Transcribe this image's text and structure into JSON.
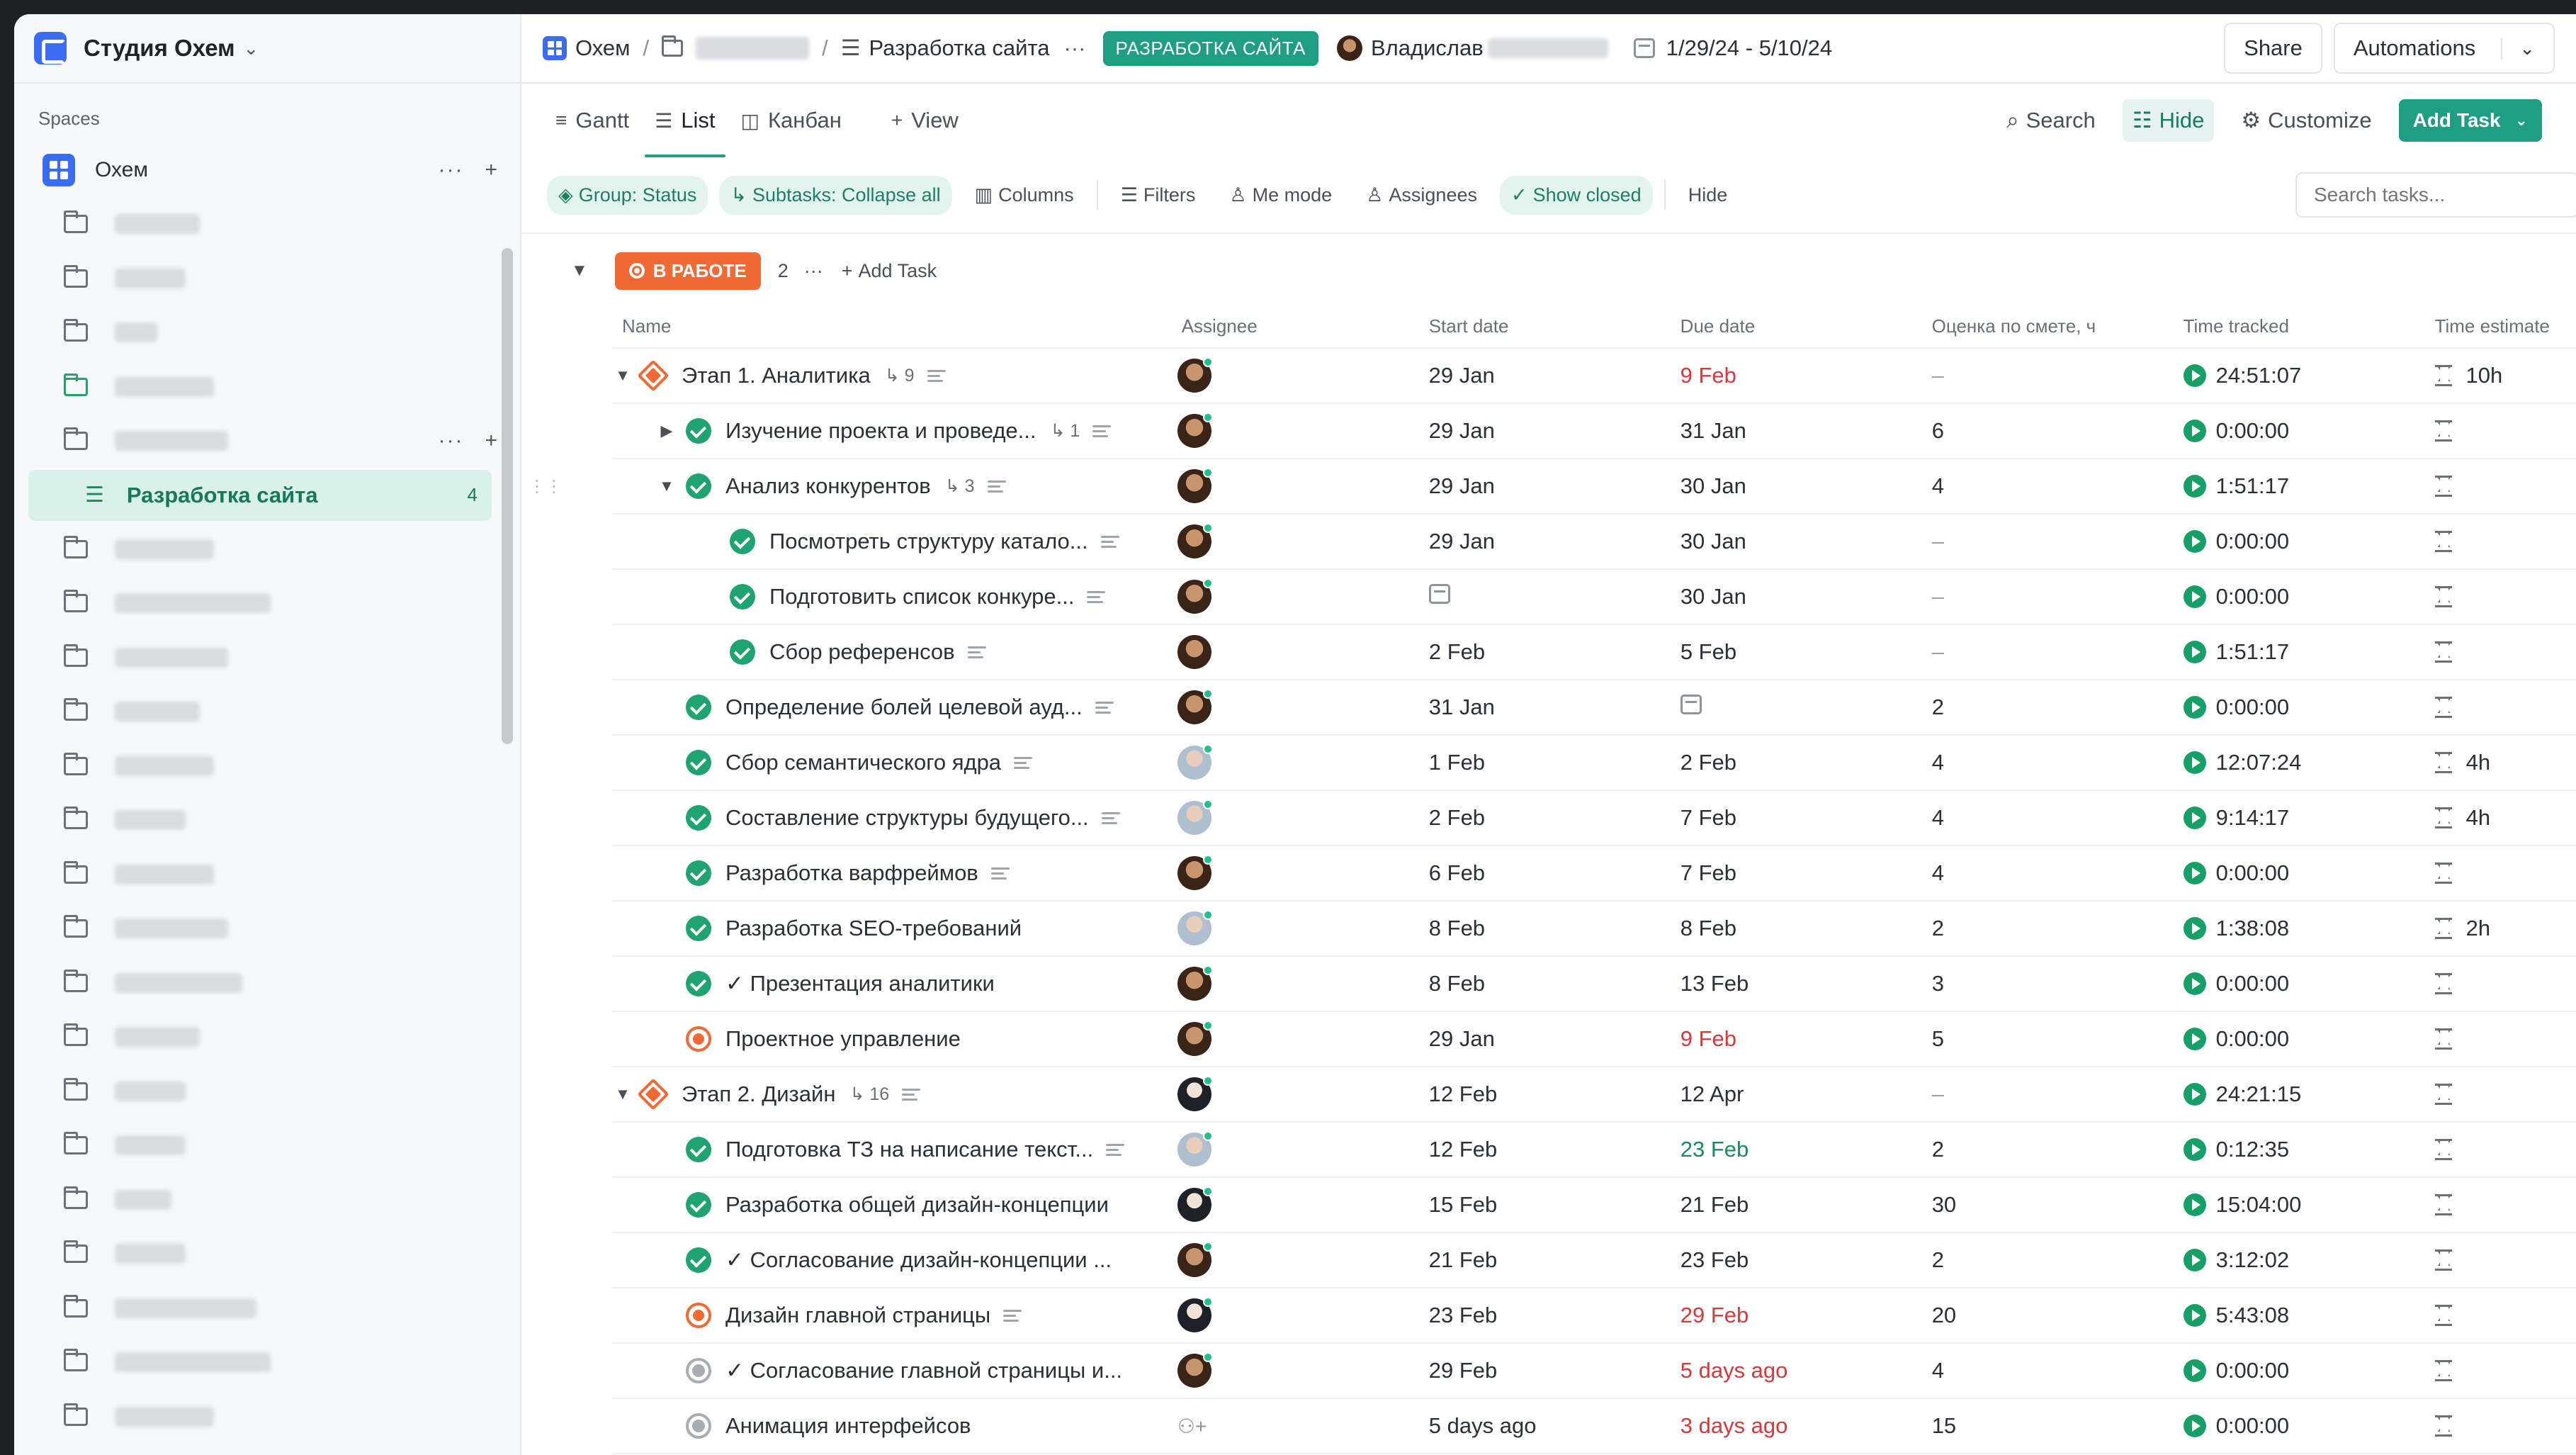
{
  "sidebar": {
    "workspace_name": "Студия Охем",
    "spaces_label": "Spaces",
    "space_name": "Охем",
    "active_list": {
      "name": "Разработка сайта",
      "count": "4"
    }
  },
  "topbar": {
    "crumb_space": "Охем",
    "crumb_list": "Разработка сайта",
    "more": "···",
    "tag": "РАЗРАБОТКА САЙТА",
    "owner": "Владислав",
    "date_range": "1/29/24 - 5/10/24",
    "share": "Share",
    "automations": "Automations"
  },
  "views": {
    "tabs": [
      {
        "icon": "gantt-icon",
        "label": "Gantt"
      },
      {
        "icon": "list-icon",
        "label": "List"
      },
      {
        "icon": "board-icon",
        "label": "Канбан"
      },
      {
        "icon": "plus-icon",
        "label": "View"
      }
    ],
    "search": "Search",
    "hide": "Hide",
    "customize": "Customize",
    "add_task": "Add Task"
  },
  "filters": {
    "group": "Group: Status",
    "subtasks": "Subtasks: Collapse all",
    "columns": "Columns",
    "filters": "Filters",
    "me_mode": "Me mode",
    "assignees": "Assignees",
    "show_closed": "Show closed",
    "hide": "Hide",
    "search_placeholder": "Search tasks..."
  },
  "group": {
    "status": "В РАБОТЕ",
    "count": "2",
    "more": "···",
    "add_task": "Add Task",
    "accent": "#f06a35"
  },
  "columns": {
    "name": "Name",
    "assignee": "Assignee",
    "start": "Start date",
    "due": "Due date",
    "estimate": "Оценка по смете, ч",
    "tracked": "Time tracked",
    "time_estimate": "Time estimate"
  },
  "tasks": [
    {
      "name": "Этап 1. Аналитика",
      "subs": "9",
      "start": "29 Jan",
      "due": "9 Feb",
      "est": "–",
      "tracked": "24:51:07",
      "te": "10h"
    },
    {
      "name": "Изучение проекта и проведе...",
      "subs": "1",
      "start": "29 Jan",
      "due": "31 Jan",
      "est": "6",
      "tracked": "0:00:00",
      "te": ""
    },
    {
      "name": "Анализ конкурентов",
      "subs": "3",
      "start": "29 Jan",
      "due": "30 Jan",
      "est": "4",
      "tracked": "1:51:17",
      "te": ""
    },
    {
      "name": "Посмотреть структуру катало...",
      "start": "29 Jan",
      "due": "30 Jan",
      "est": "–",
      "tracked": "0:00:00",
      "te": ""
    },
    {
      "name": "Подготовить список конкуре...",
      "start": "",
      "due": "30 Jan",
      "est": "–",
      "tracked": "0:00:00",
      "te": ""
    },
    {
      "name": "Сбор референсов",
      "start": "2 Feb",
      "due": "5 Feb",
      "est": "–",
      "tracked": "1:51:17",
      "te": ""
    },
    {
      "name": "Определение болей целевой ауд...",
      "start": "31 Jan",
      "due": "",
      "est": "2",
      "tracked": "0:00:00",
      "te": ""
    },
    {
      "name": "Сбор семантического ядра",
      "start": "1 Feb",
      "due": "2 Feb",
      "est": "4",
      "tracked": "12:07:24",
      "te": "4h"
    },
    {
      "name": "Составление структуры будущего...",
      "start": "2 Feb",
      "due": "7 Feb",
      "est": "4",
      "tracked": "9:14:17",
      "te": "4h"
    },
    {
      "name": "Разработка варфреймов",
      "start": "6 Feb",
      "due": "7 Feb",
      "est": "4",
      "tracked": "0:00:00",
      "te": ""
    },
    {
      "name": "Разработка SEO-требований",
      "start": "8 Feb",
      "due": "8 Feb",
      "est": "2",
      "tracked": "1:38:08",
      "te": "2h"
    },
    {
      "name": "✓ Презентация аналитики",
      "start": "8 Feb",
      "due": "13 Feb",
      "est": "3",
      "tracked": "0:00:00",
      "te": ""
    },
    {
      "name": "Проектное управление",
      "start": "29 Jan",
      "due": "9 Feb",
      "est": "5",
      "tracked": "0:00:00",
      "te": ""
    },
    {
      "name": "Этап 2. Дизайн",
      "subs": "16",
      "start": "12 Feb",
      "due": "12 Apr",
      "est": "–",
      "tracked": "24:21:15",
      "te": ""
    },
    {
      "name": "Подготовка ТЗ на написание текст...",
      "start": "12 Feb",
      "due": "23 Feb",
      "est": "2",
      "tracked": "0:12:35",
      "te": ""
    },
    {
      "name": "Разработка общей дизайн-концепции",
      "start": "15 Feb",
      "due": "21 Feb",
      "est": "30",
      "tracked": "15:04:00",
      "te": ""
    },
    {
      "name": "✓ Согласование дизайн-концепции ...",
      "start": "21 Feb",
      "due": "23 Feb",
      "est": "2",
      "tracked": "3:12:02",
      "te": ""
    },
    {
      "name": "Дизайн главной страницы",
      "start": "23 Feb",
      "due": "29 Feb",
      "est": "20",
      "tracked": "5:43:08",
      "te": ""
    },
    {
      "name": "✓ Согласование главной страницы и...",
      "start": "29 Feb",
      "due": "5 days ago",
      "est": "4",
      "tracked": "0:00:00",
      "te": ""
    },
    {
      "name": "Анимация интерфейсов",
      "start": "5 days ago",
      "due": "3 days ago",
      "est": "15",
      "tracked": "0:00:00",
      "te": ""
    }
  ],
  "colors": {
    "brand": "#1f9e83",
    "overdue": "#d9383a",
    "in_progress": "#f06a35",
    "done": "#1ea371"
  }
}
